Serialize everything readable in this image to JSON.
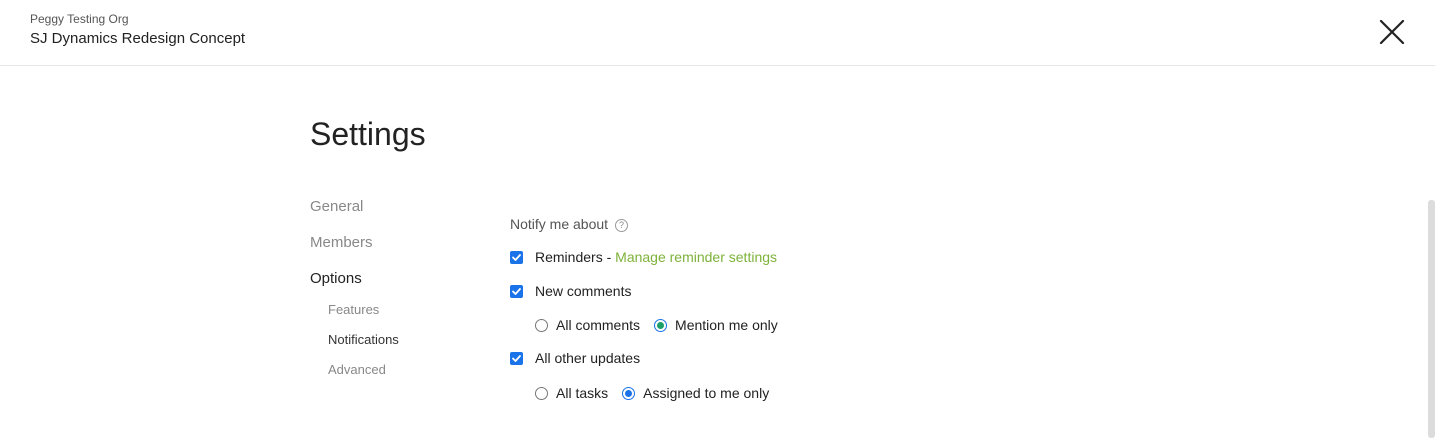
{
  "header": {
    "org_name": "Peggy Testing Org",
    "project_name": "SJ Dynamics Redesign Concept",
    "close_icon": "close-icon"
  },
  "page": {
    "title": "Settings"
  },
  "nav": {
    "items": [
      {
        "label": "General",
        "active": false
      },
      {
        "label": "Members",
        "active": false
      },
      {
        "label": "Options",
        "active": true
      }
    ],
    "subitems": [
      {
        "label": "Features",
        "active": false
      },
      {
        "label": "Notifications",
        "active": true
      },
      {
        "label": "Advanced",
        "active": false
      }
    ]
  },
  "notifications": {
    "section_label": "Notify me about",
    "help_icon": "help-icon",
    "reminders": {
      "checked": true,
      "label": "Reminders",
      "separator": " - ",
      "link": "Manage reminder settings"
    },
    "new_comments": {
      "checked": true,
      "label": "New comments",
      "options": [
        {
          "label": "All comments",
          "selected": false
        },
        {
          "label": "Mention me only",
          "selected": true
        }
      ]
    },
    "all_other_updates": {
      "checked": true,
      "label": "All other updates",
      "options": [
        {
          "label": "All tasks",
          "selected": false
        },
        {
          "label": "Assigned to me only",
          "selected": true
        }
      ]
    }
  },
  "colors": {
    "accent": "#1a73e8",
    "link": "#7db23a",
    "mention_radio": "#1e9e6a"
  }
}
